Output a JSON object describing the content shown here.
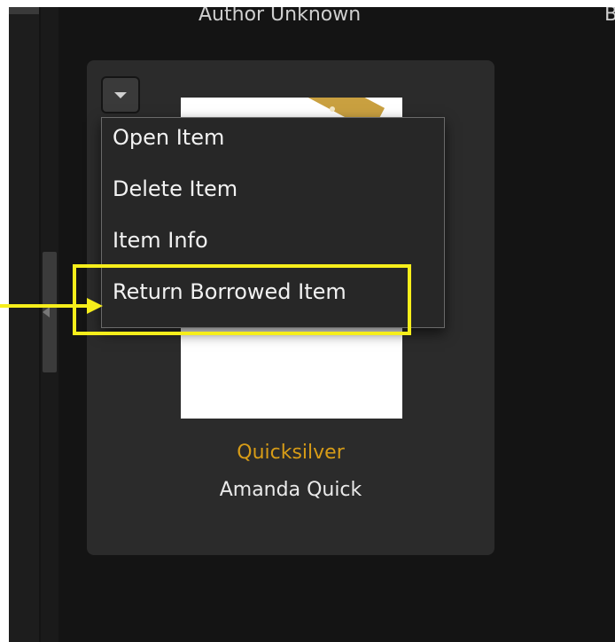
{
  "header": {
    "author_above": "Author Unknown",
    "right_clipped_text": "B"
  },
  "book": {
    "title": "Quicksilver",
    "author": "Amanda Quick"
  },
  "menu": {
    "items": [
      {
        "label": "Open Item"
      },
      {
        "label": "Delete Item"
      },
      {
        "label": "Item Info"
      },
      {
        "label": "Return Borrowed Item"
      }
    ]
  },
  "annotation": {
    "highlighted_item": "Return Borrowed Item",
    "color": "#f6ee1b"
  },
  "colors": {
    "background": "#141414",
    "card": "#2b2b2b",
    "title_accent": "#d79c17",
    "text": "#eaeaea"
  },
  "icons": {
    "dropdown": "triangle-down-icon",
    "cover_tag": "bookmark-tag-icon",
    "annotation_arrow": "arrow-right-icon"
  }
}
